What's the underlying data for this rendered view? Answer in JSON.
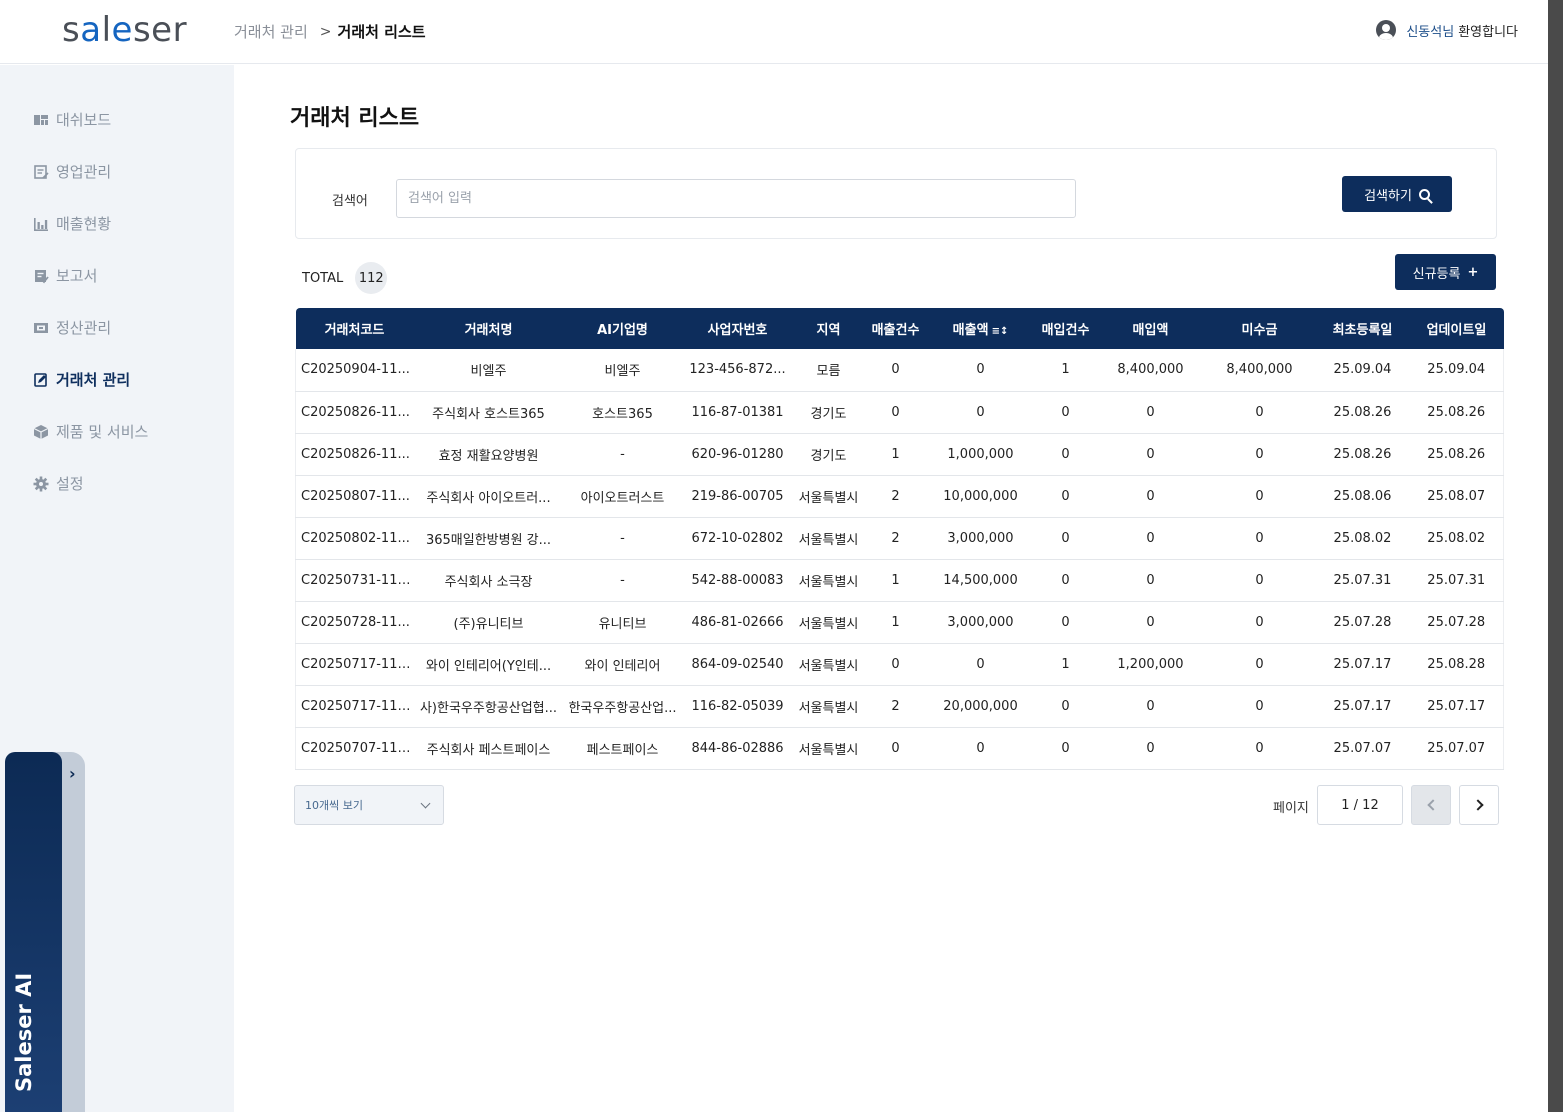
{
  "brand": {
    "logo_part1": "s",
    "logo_accent": "a",
    "logo_part2": "l",
    "logo_accent2": "e",
    "logo_part3": "ser"
  },
  "breadcrumb": {
    "parent": "거래처 관리",
    "separator": ">",
    "current": "거래처 리스트"
  },
  "user": {
    "name": "신동석님",
    "greeting": "환영합니다"
  },
  "sidebar": {
    "items": [
      {
        "label": "대쉬보드",
        "icon": "dashboard-icon"
      },
      {
        "label": "영업관리",
        "icon": "document-edit-icon"
      },
      {
        "label": "매출현황",
        "icon": "bar-chart-icon"
      },
      {
        "label": "보고서",
        "icon": "report-icon"
      },
      {
        "label": "정산관리",
        "icon": "settlement-icon"
      },
      {
        "label": "거래처 관리",
        "icon": "client-edit-icon",
        "active": true
      },
      {
        "label": "제품 및 서비스",
        "icon": "package-icon"
      },
      {
        "label": "설정",
        "icon": "gear-icon"
      }
    ]
  },
  "ai_panel": {
    "label": "Saleser AI",
    "toggle": "›"
  },
  "page": {
    "title": "거래처 리스트"
  },
  "search": {
    "label": "검색어",
    "placeholder": "검색어 입력",
    "value": "",
    "button_label": "검색하기"
  },
  "summary": {
    "total_label": "TOTAL",
    "total_count": "112"
  },
  "actions": {
    "new_label": "신규등록",
    "new_plus": "+"
  },
  "table": {
    "columns": [
      "거래처코드",
      "거래처명",
      "AI기업명",
      "사업자번호",
      "지역",
      "매출건수",
      "매출액",
      "매입건수",
      "매입액",
      "미수금",
      "최초등록일",
      "업데이트일"
    ],
    "sort_indicator": "≡↕",
    "rows": [
      [
        "C20250904-11...",
        "비엘주",
        "비엘주",
        "123-456-872...",
        "모름",
        "0",
        "0",
        "1",
        "8,400,000",
        "8,400,000",
        "25.09.04",
        "25.09.04"
      ],
      [
        "C20250826-11...",
        "주식회사 호스트365",
        "호스트365",
        "116-87-01381",
        "경기도",
        "0",
        "0",
        "0",
        "0",
        "0",
        "25.08.26",
        "25.08.26"
      ],
      [
        "C20250826-11...",
        "효정 재활요양병원",
        "-",
        "620-96-01280",
        "경기도",
        "1",
        "1,000,000",
        "0",
        "0",
        "0",
        "25.08.26",
        "25.08.26"
      ],
      [
        "C20250807-11...",
        "주식회사 아이오트러...",
        "아이오트러스트",
        "219-86-00705",
        "서울특별시",
        "2",
        "10,000,000",
        "0",
        "0",
        "0",
        "25.08.06",
        "25.08.07"
      ],
      [
        "C20250802-11...",
        "365매일한방병원 강...",
        "-",
        "672-10-02802",
        "서울특별시",
        "2",
        "3,000,000",
        "0",
        "0",
        "0",
        "25.08.02",
        "25.08.02"
      ],
      [
        "C20250731-112...",
        "주식회사 소극장",
        "-",
        "542-88-00083",
        "서울특별시",
        "1",
        "14,500,000",
        "0",
        "0",
        "0",
        "25.07.31",
        "25.07.31"
      ],
      [
        "C20250728-11...",
        "(주)유니티브",
        "유니티브",
        "486-81-02666",
        "서울특별시",
        "1",
        "3,000,000",
        "0",
        "0",
        "0",
        "25.07.28",
        "25.07.28"
      ],
      [
        "C20250717-112...",
        "와이 인테리어(Y인테...",
        "와이 인테리어",
        "864-09-02540",
        "서울특별시",
        "0",
        "0",
        "1",
        "1,200,000",
        "0",
        "25.07.17",
        "25.08.28"
      ],
      [
        "C20250717-110...",
        "사)한국우주항공산업협...",
        "한국우주항공산업...",
        "116-82-05039",
        "서울특별시",
        "2",
        "20,000,000",
        "0",
        "0",
        "0",
        "25.07.17",
        "25.07.17"
      ],
      [
        "C20250707-112...",
        "주식회사 페스트페이스",
        "페스트페이스",
        "844-86-02886",
        "서울특별시",
        "0",
        "0",
        "0",
        "0",
        "0",
        "25.07.07",
        "25.07.07"
      ]
    ]
  },
  "pagination": {
    "page_size_label": "10개씩 보기",
    "page_label": "페이지",
    "current": "1 / 12"
  },
  "colors": {
    "primary": "#0d2d5c",
    "sidebar_bg": "#f1f4f8",
    "logo_accent": "#1565c0"
  }
}
